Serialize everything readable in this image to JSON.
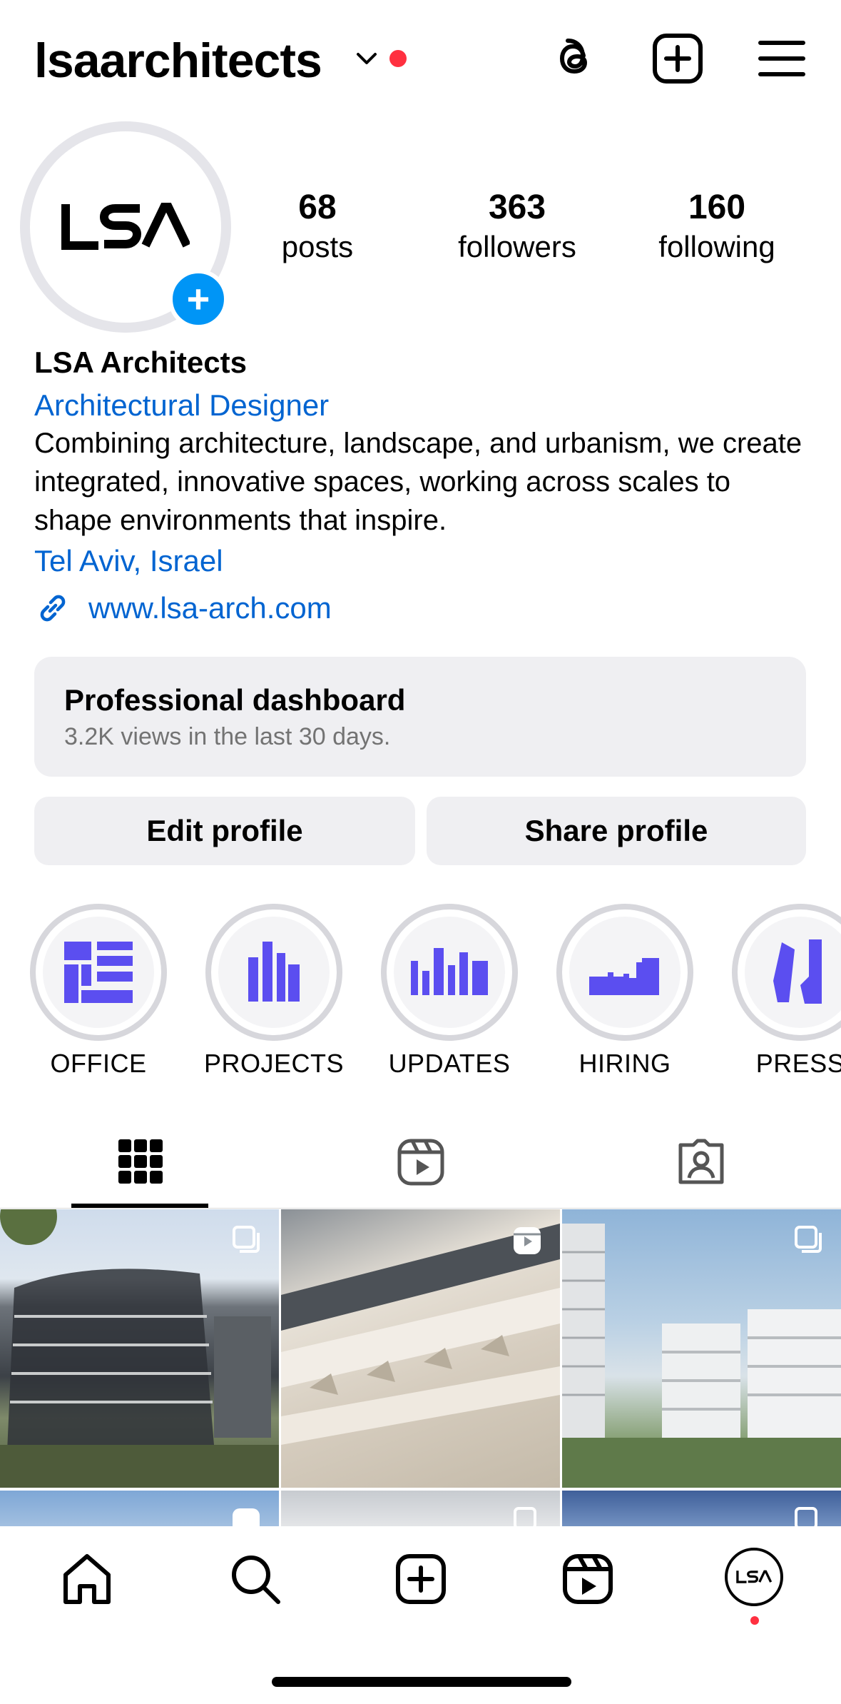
{
  "header": {
    "username": "lsaarchitects",
    "icons": [
      "chevron-down-icon",
      "threads-icon",
      "create-icon",
      "menu-icon"
    ]
  },
  "profile": {
    "stats": [
      {
        "number": "68",
        "label": "posts"
      },
      {
        "number": "363",
        "label": "followers"
      },
      {
        "number": "160",
        "label": "following"
      }
    ],
    "avatar_logo": "LSA",
    "display_name": "LSA Architects",
    "category": "Architectural Designer",
    "bio": "Combining architecture, landscape, and urbanism, we create integrated, innovative spaces, working across scales to shape environments that inspire.",
    "location": "Tel Aviv, Israel",
    "website": "www.lsa-arch.com"
  },
  "dashboard": {
    "title": "Professional dashboard",
    "subtitle": "3.2K views in the last 30 days."
  },
  "actions": {
    "edit": "Edit profile",
    "share": "Share profile"
  },
  "highlights": [
    {
      "label": "OFFICE"
    },
    {
      "label": "PROJECTS"
    },
    {
      "label": "UPDATES"
    },
    {
      "label": "HIRING"
    },
    {
      "label": "PRESS"
    }
  ],
  "tabs": [
    "grid-icon",
    "reels-icon",
    "tagged-icon"
  ],
  "bottom_nav": [
    "home-icon",
    "search-icon",
    "create-icon",
    "reels-icon",
    "profile-avatar"
  ],
  "colors": {
    "link": "#0064d1",
    "accent_blue": "#0095f6",
    "notification_red": "#ff3040",
    "highlight_purple": "#5b4ef0",
    "button_bg": "#efeff2"
  }
}
